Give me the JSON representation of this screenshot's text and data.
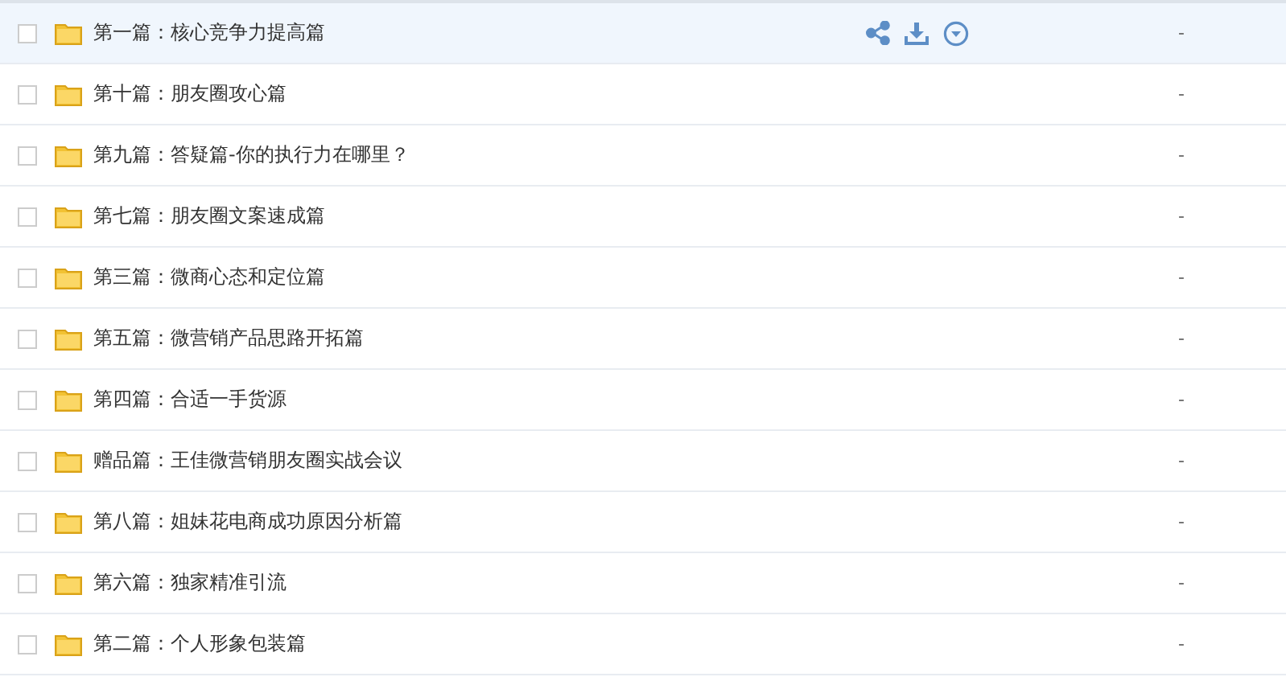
{
  "files": [
    {
      "name": "第一篇：核心竞争力提高篇",
      "size": "-",
      "checked": false,
      "hovered": true
    },
    {
      "name": "第十篇：朋友圈攻心篇",
      "size": "-",
      "checked": false,
      "hovered": false
    },
    {
      "name": "第九篇：答疑篇-你的执行力在哪里？",
      "size": "-",
      "checked": false,
      "hovered": false
    },
    {
      "name": "第七篇：朋友圈文案速成篇",
      "size": "-",
      "checked": false,
      "hovered": false
    },
    {
      "name": "第三篇：微商心态和定位篇",
      "size": "-",
      "checked": false,
      "hovered": false
    },
    {
      "name": "第五篇：微营销产品思路开拓篇",
      "size": "-",
      "checked": false,
      "hovered": false
    },
    {
      "name": "第四篇：合适一手货源",
      "size": "-",
      "checked": false,
      "hovered": false
    },
    {
      "name": "赠品篇：王佳微营销朋友圈实战会议",
      "size": "-",
      "checked": false,
      "hovered": false
    },
    {
      "name": "第八篇：姐妹花电商成功原因分析篇",
      "size": "-",
      "checked": false,
      "hovered": false
    },
    {
      "name": "第六篇：独家精准引流",
      "size": "-",
      "checked": false,
      "hovered": false
    },
    {
      "name": "第二篇：个人形象包装篇",
      "size": "-",
      "checked": false,
      "hovered": false
    }
  ]
}
